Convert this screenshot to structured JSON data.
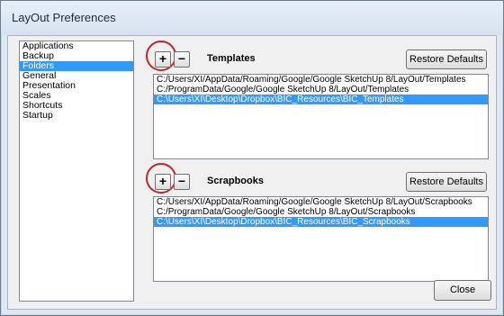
{
  "window": {
    "title": "LayOut Preferences"
  },
  "categories": [
    {
      "label": "Applications",
      "selected": false
    },
    {
      "label": "Backup",
      "selected": false
    },
    {
      "label": "Folders",
      "selected": true
    },
    {
      "label": "General",
      "selected": false
    },
    {
      "label": "Presentation",
      "selected": false
    },
    {
      "label": "Scales",
      "selected": false
    },
    {
      "label": "Shortcuts",
      "selected": false
    },
    {
      "label": "Startup",
      "selected": false
    }
  ],
  "templates": {
    "add_label": "+",
    "remove_label": "−",
    "title": "Templates",
    "restore_label": "Restore Defaults",
    "paths": [
      "C:/Users/XI/AppData/Roaming/Google/Google SketchUp 8/LayOut/Templates",
      "C:/ProgramData/Google/Google SketchUp 8/LayOut/Templates",
      "C:\\Users\\XI\\Desktop\\Dropbox\\BIC_Resources\\BIC_Templates"
    ],
    "selected_index": 2
  },
  "scrapbooks": {
    "add_label": "+",
    "remove_label": "−",
    "title": "Scrapbooks",
    "restore_label": "Restore Defaults",
    "paths": [
      "C:/Users/XI/AppData/Roaming/Google/Google SketchUp 8/LayOut/Scrapbooks",
      "C:/ProgramData/Google/Google SketchUp 8/LayOut/Scrapbooks",
      "C:\\Users\\XI\\Desktop\\Dropbox\\BIC_Resources\\BIC_Scrapbooks"
    ],
    "selected_index": 2
  },
  "footer": {
    "close_label": "Close"
  },
  "colors": {
    "highlight": "#3399ff",
    "annotation_ring": "#c0262c"
  }
}
